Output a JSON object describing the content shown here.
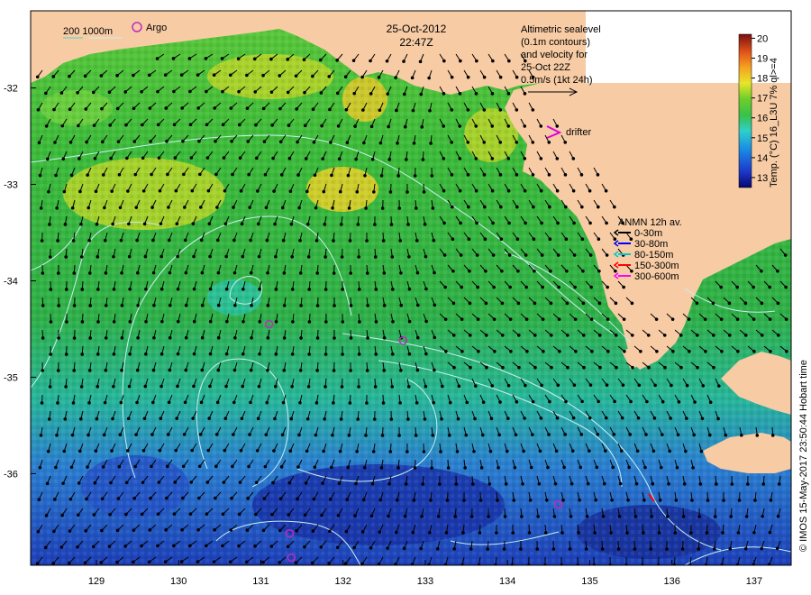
{
  "date": "25-Oct-2012",
  "time": "22:47Z",
  "altimetry_text": [
    "Altimetric sealevel",
    "(0.1m contours)",
    "and velocity for",
    "25-Oct 22Z",
    "0.5m/s (1kt 24h)"
  ],
  "bathy_legend": "200  1000m",
  "argo_label": "Argo",
  "drifter_label": "drifter",
  "anmn": {
    "title": "ANMN 12h av.",
    "items": [
      {
        "label": "0-30m",
        "color": "#000000"
      },
      {
        "label": "30-80m",
        "color": "#0000ff"
      },
      {
        "label": "80-150m",
        "color": "#00c8c8"
      },
      {
        "label": "150-300m",
        "color": "#ff0000"
      },
      {
        "label": "300-600m",
        "color": "#ff00ff"
      }
    ]
  },
  "colorbar": {
    "label": "Temp. (°C) 16_L3U 7% ql>=4",
    "ticks": [
      "20",
      "19",
      "18",
      "17",
      "16",
      "15",
      "14",
      "13"
    ],
    "min": 12.5,
    "max": 20.2
  },
  "credit": "© IMOS 15-May-2017 23:50:44 Hobart time",
  "axes": {
    "lon_ticks": [
      "129",
      "130",
      "131",
      "132",
      "133",
      "134",
      "135",
      "136",
      "137"
    ],
    "lat_ticks": [
      "-32",
      "-33",
      "-34",
      "-35",
      "-36"
    ],
    "lon_range": [
      128.2,
      137.45
    ],
    "lat_range": [
      -31.2,
      -36.95
    ]
  },
  "argo_floats": [
    [
      131.1,
      -34.45
    ],
    [
      132.73,
      -34.62
    ],
    [
      131.35,
      -36.62
    ],
    [
      131.37,
      -36.87
    ],
    [
      134.62,
      -36.32
    ]
  ],
  "colors": {
    "land": "#f7cba4",
    "sea_warm": "#33cc33",
    "sea_cool": "#1a5ccf",
    "contour": "#c8f0f0"
  }
}
